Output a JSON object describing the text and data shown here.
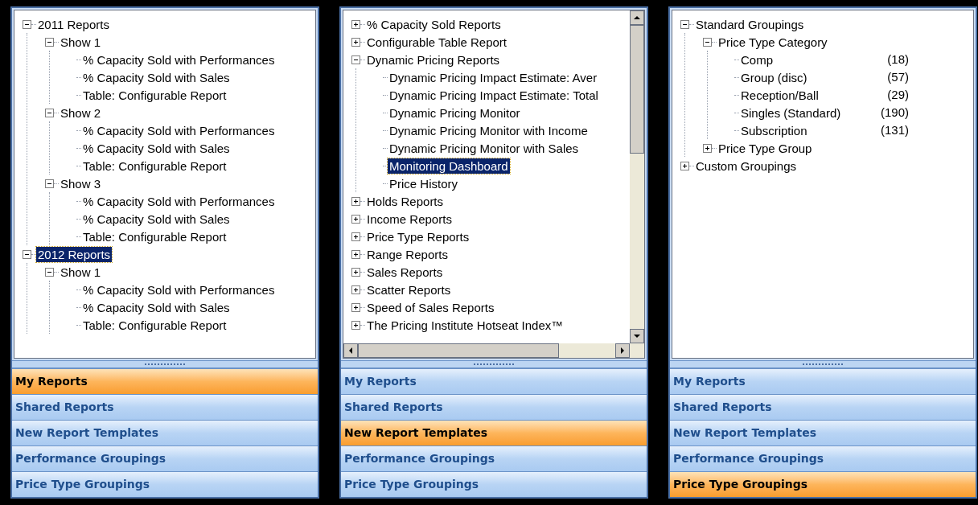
{
  "panels": [
    {
      "scrollbars": false,
      "tree": [
        {
          "label": "2011 Reports",
          "expanded": true,
          "selected": false,
          "children": [
            {
              "label": "Show 1",
              "expanded": true,
              "selected": false,
              "children": [
                {
                  "label": "% Capacity Sold with Performances",
                  "selected": false
                },
                {
                  "label": "% Capacity Sold with Sales",
                  "selected": false
                },
                {
                  "label": "Table: Configurable Report",
                  "selected": false
                }
              ]
            },
            {
              "label": "Show 2",
              "expanded": true,
              "selected": false,
              "children": [
                {
                  "label": "% Capacity Sold with Performances",
                  "selected": false
                },
                {
                  "label": "% Capacity Sold with Sales",
                  "selected": false
                },
                {
                  "label": "Table: Configurable Report",
                  "selected": false
                }
              ]
            },
            {
              "label": "Show 3",
              "expanded": true,
              "selected": false,
              "children": [
                {
                  "label": "% Capacity Sold with Performances",
                  "selected": false
                },
                {
                  "label": "% Capacity Sold with Sales",
                  "selected": false
                },
                {
                  "label": "Table: Configurable Report",
                  "selected": false
                }
              ]
            }
          ]
        },
        {
          "label": "2012 Reports",
          "expanded": true,
          "selected": true,
          "children": [
            {
              "label": "Show 1",
              "expanded": true,
              "selected": false,
              "children": [
                {
                  "label": "% Capacity Sold with Performances",
                  "selected": false
                },
                {
                  "label": "% Capacity Sold with Sales",
                  "selected": false
                },
                {
                  "label": "Table: Configurable Report",
                  "selected": false
                }
              ]
            }
          ]
        }
      ],
      "nav": [
        {
          "label": "My Reports",
          "selected": true
        },
        {
          "label": "Shared Reports",
          "selected": false
        },
        {
          "label": "New Report Templates",
          "selected": false
        },
        {
          "label": "Performance Groupings",
          "selected": false
        },
        {
          "label": "Price Type Groupings",
          "selected": false
        }
      ]
    },
    {
      "scrollbars": true,
      "tree": [
        {
          "label": "% Capacity Sold Reports",
          "expanded": false,
          "selected": false
        },
        {
          "label": "Configurable Table Report",
          "expanded": false,
          "selected": false
        },
        {
          "label": "Dynamic Pricing Reports",
          "expanded": true,
          "selected": false,
          "children": [
            {
              "label": "Dynamic Pricing Impact Estimate: Aver",
              "selected": false
            },
            {
              "label": "Dynamic Pricing Impact Estimate: Total",
              "selected": false
            },
            {
              "label": "Dynamic Pricing Monitor",
              "selected": false
            },
            {
              "label": "Dynamic Pricing Monitor with Income",
              "selected": false
            },
            {
              "label": "Dynamic Pricing Monitor with Sales",
              "selected": false
            },
            {
              "label": "Monitoring Dashboard",
              "selected": true
            },
            {
              "label": "Price History",
              "selected": false
            }
          ]
        },
        {
          "label": "Holds Reports",
          "expanded": false,
          "selected": false
        },
        {
          "label": "Income Reports",
          "expanded": false,
          "selected": false
        },
        {
          "label": "Price Type Reports",
          "expanded": false,
          "selected": false
        },
        {
          "label": "Range Reports",
          "expanded": false,
          "selected": false
        },
        {
          "label": "Sales Reports",
          "expanded": false,
          "selected": false
        },
        {
          "label": "Scatter Reports",
          "expanded": false,
          "selected": false
        },
        {
          "label": "Speed of Sales Reports",
          "expanded": false,
          "selected": false
        },
        {
          "label": "The Pricing Institute Hotseat Index™",
          "expanded": false,
          "selected": false
        }
      ],
      "nav": [
        {
          "label": "My Reports",
          "selected": false
        },
        {
          "label": "Shared Reports",
          "selected": false
        },
        {
          "label": "New Report Templates",
          "selected": true
        },
        {
          "label": "Performance Groupings",
          "selected": false
        },
        {
          "label": "Price Type Groupings",
          "selected": false
        }
      ]
    },
    {
      "scrollbars": false,
      "tree": [
        {
          "label": "Standard Groupings",
          "expanded": true,
          "selected": false,
          "children": [
            {
              "label": "Price Type Category",
              "expanded": true,
              "selected": false,
              "children": [
                {
                  "label": "Comp",
                  "count": "(18)",
                  "selected": false
                },
                {
                  "label": "Group (disc)",
                  "count": "(57)",
                  "selected": false
                },
                {
                  "label": "Reception/Ball",
                  "count": "(29)",
                  "selected": false
                },
                {
                  "label": "Singles (Standard)",
                  "count": "(190)",
                  "selected": false
                },
                {
                  "label": "Subscription",
                  "count": "(131)",
                  "selected": false
                }
              ]
            },
            {
              "label": "Price Type Group",
              "expanded": false,
              "selected": false
            }
          ]
        },
        {
          "label": "Custom Groupings",
          "expanded": false,
          "selected": false
        }
      ],
      "nav": [
        {
          "label": "My Reports",
          "selected": false
        },
        {
          "label": "Shared Reports",
          "selected": false
        },
        {
          "label": "New Report Templates",
          "selected": false
        },
        {
          "label": "Performance Groupings",
          "selected": false
        },
        {
          "label": "Price Type Groupings",
          "selected": true
        }
      ]
    }
  ]
}
